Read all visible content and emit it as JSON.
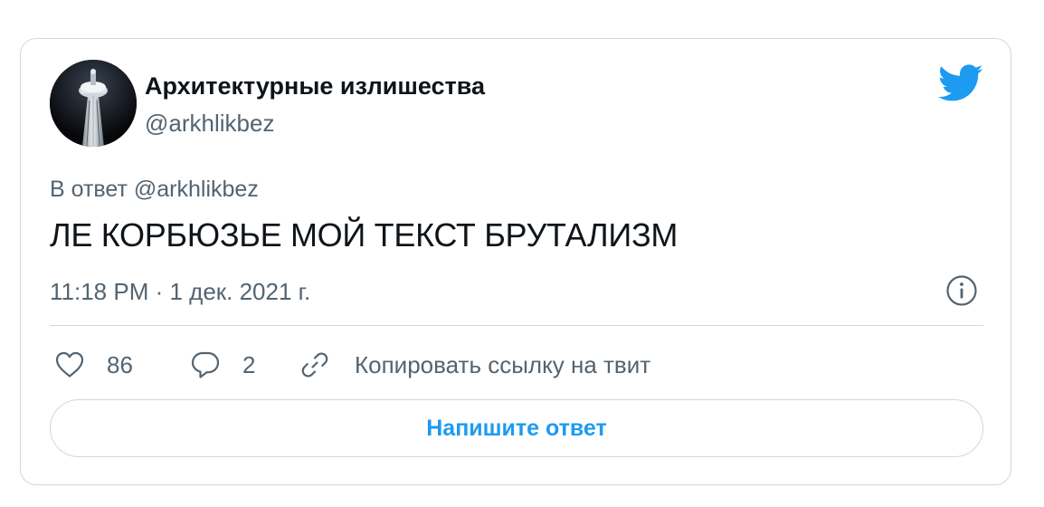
{
  "author": {
    "display_name": "Архитектурные излишества",
    "handle": "@arkhlikbez"
  },
  "tweet": {
    "reply_to": "В ответ @arkhlikbez",
    "text": "ЛЕ КОРБЮЗЬЕ МОЙ ТЕКСТ БРУТАЛИЗМ",
    "timestamp": "11:18 PM · 1 дек. 2021 г."
  },
  "actions": {
    "likes": "86",
    "replies": "2",
    "copy_link_label": "Копировать ссылку на твит"
  },
  "reply_button_label": "Напишите ответ",
  "icons": {
    "brand": "twitter-bird-icon",
    "info": "info-icon",
    "like": "heart-icon",
    "reply": "speech-bubble-icon",
    "copy": "link-icon"
  },
  "colors": {
    "brand_blue": "#1d9bf0",
    "text_primary": "#0f1419",
    "text_secondary": "#536471",
    "border": "#cfd9de"
  }
}
